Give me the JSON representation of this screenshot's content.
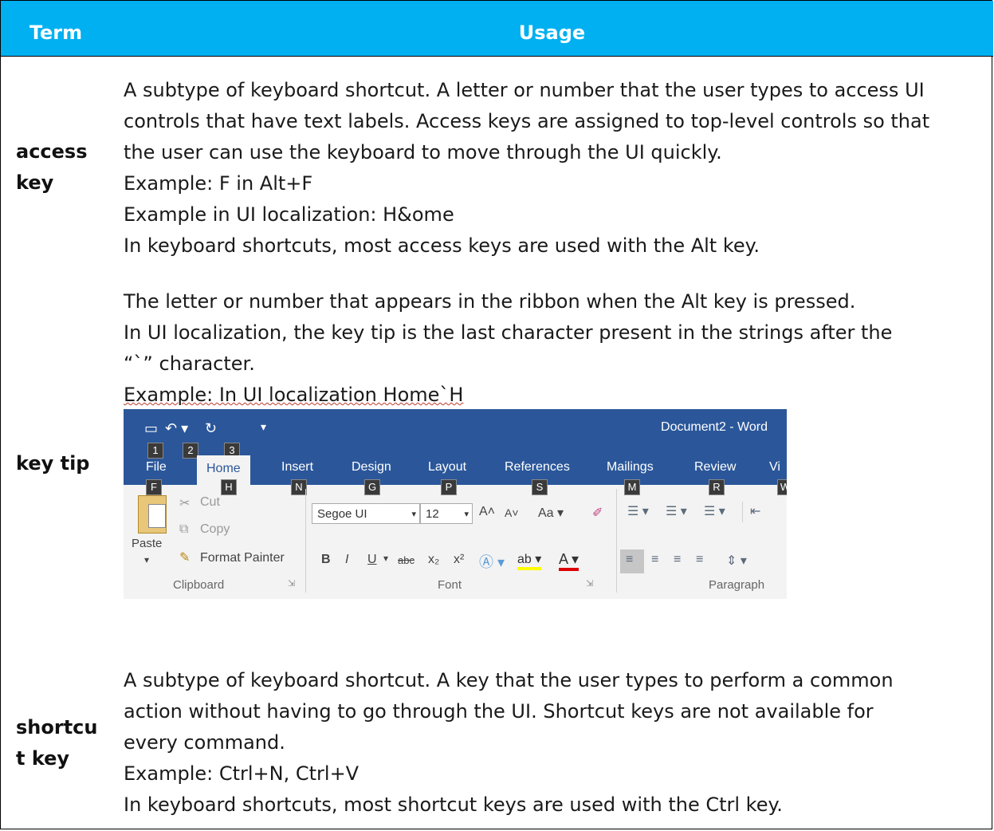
{
  "header": {
    "term": "Term",
    "usage": "Usage"
  },
  "rows": [
    {
      "term": "access key",
      "usage": [
        "A subtype of keyboard shortcut. A letter or number that the user types to access UI",
        "controls that have text labels. Access keys are assigned to top-level controls so that",
        "the user can use the keyboard to move through the UI quickly.",
        "Example: F in Alt+F",
        "Example in UI localization: H&ome",
        "In keyboard shortcuts, most access keys are used with the Alt key."
      ]
    },
    {
      "term": "key tip",
      "usage": [
        "The letter or number that appears in the ribbon when the Alt key is pressed.",
        "In UI localization, the key tip is the last character present in the strings after the",
        "“`” character.",
        "Example: In UI localization Home`H"
      ]
    },
    {
      "term": "shortcut key",
      "usage": [
        "A subtype of keyboard shortcut. A key that the user types to perform a common",
        "action without having to go through the UI. Shortcut keys are not available for",
        "every command.",
        "Example: Ctrl+N, Ctrl+V",
        "In keyboard shortcuts, most shortcut keys are used with the Ctrl key."
      ]
    }
  ],
  "term_lines": {
    "access_key": [
      "access",
      "key"
    ],
    "shortcut_key": [
      "shortcu",
      "t key"
    ]
  },
  "ribbon": {
    "document_title": "Document2 - Word",
    "qat_keytips": [
      "1",
      "2",
      "3"
    ],
    "tabs": [
      {
        "label": "File",
        "keytip": "F"
      },
      {
        "label": "Home",
        "keytip": "H"
      },
      {
        "label": "Insert",
        "keytip": "N"
      },
      {
        "label": "Design",
        "keytip": "G"
      },
      {
        "label": "Layout",
        "keytip": "P"
      },
      {
        "label": "References",
        "keytip": "S"
      },
      {
        "label": "Mailings",
        "keytip": "M"
      },
      {
        "label": "Review",
        "keytip": "R"
      },
      {
        "label": "Vi",
        "keytip": "W"
      }
    ],
    "clipboard": {
      "cut": "Cut",
      "copy": "Copy",
      "paste": "Paste",
      "format_painter": "Format Painter",
      "label": "Clipboard"
    },
    "font": {
      "name": "Segoe UI",
      "size": "12",
      "case": "Aa",
      "label": "Font",
      "bold": "B",
      "italic": "I",
      "underline": "U",
      "strike": "abc",
      "sub": "x₂",
      "sup": "x²"
    },
    "paragraph": {
      "label": "Paragraph"
    }
  }
}
